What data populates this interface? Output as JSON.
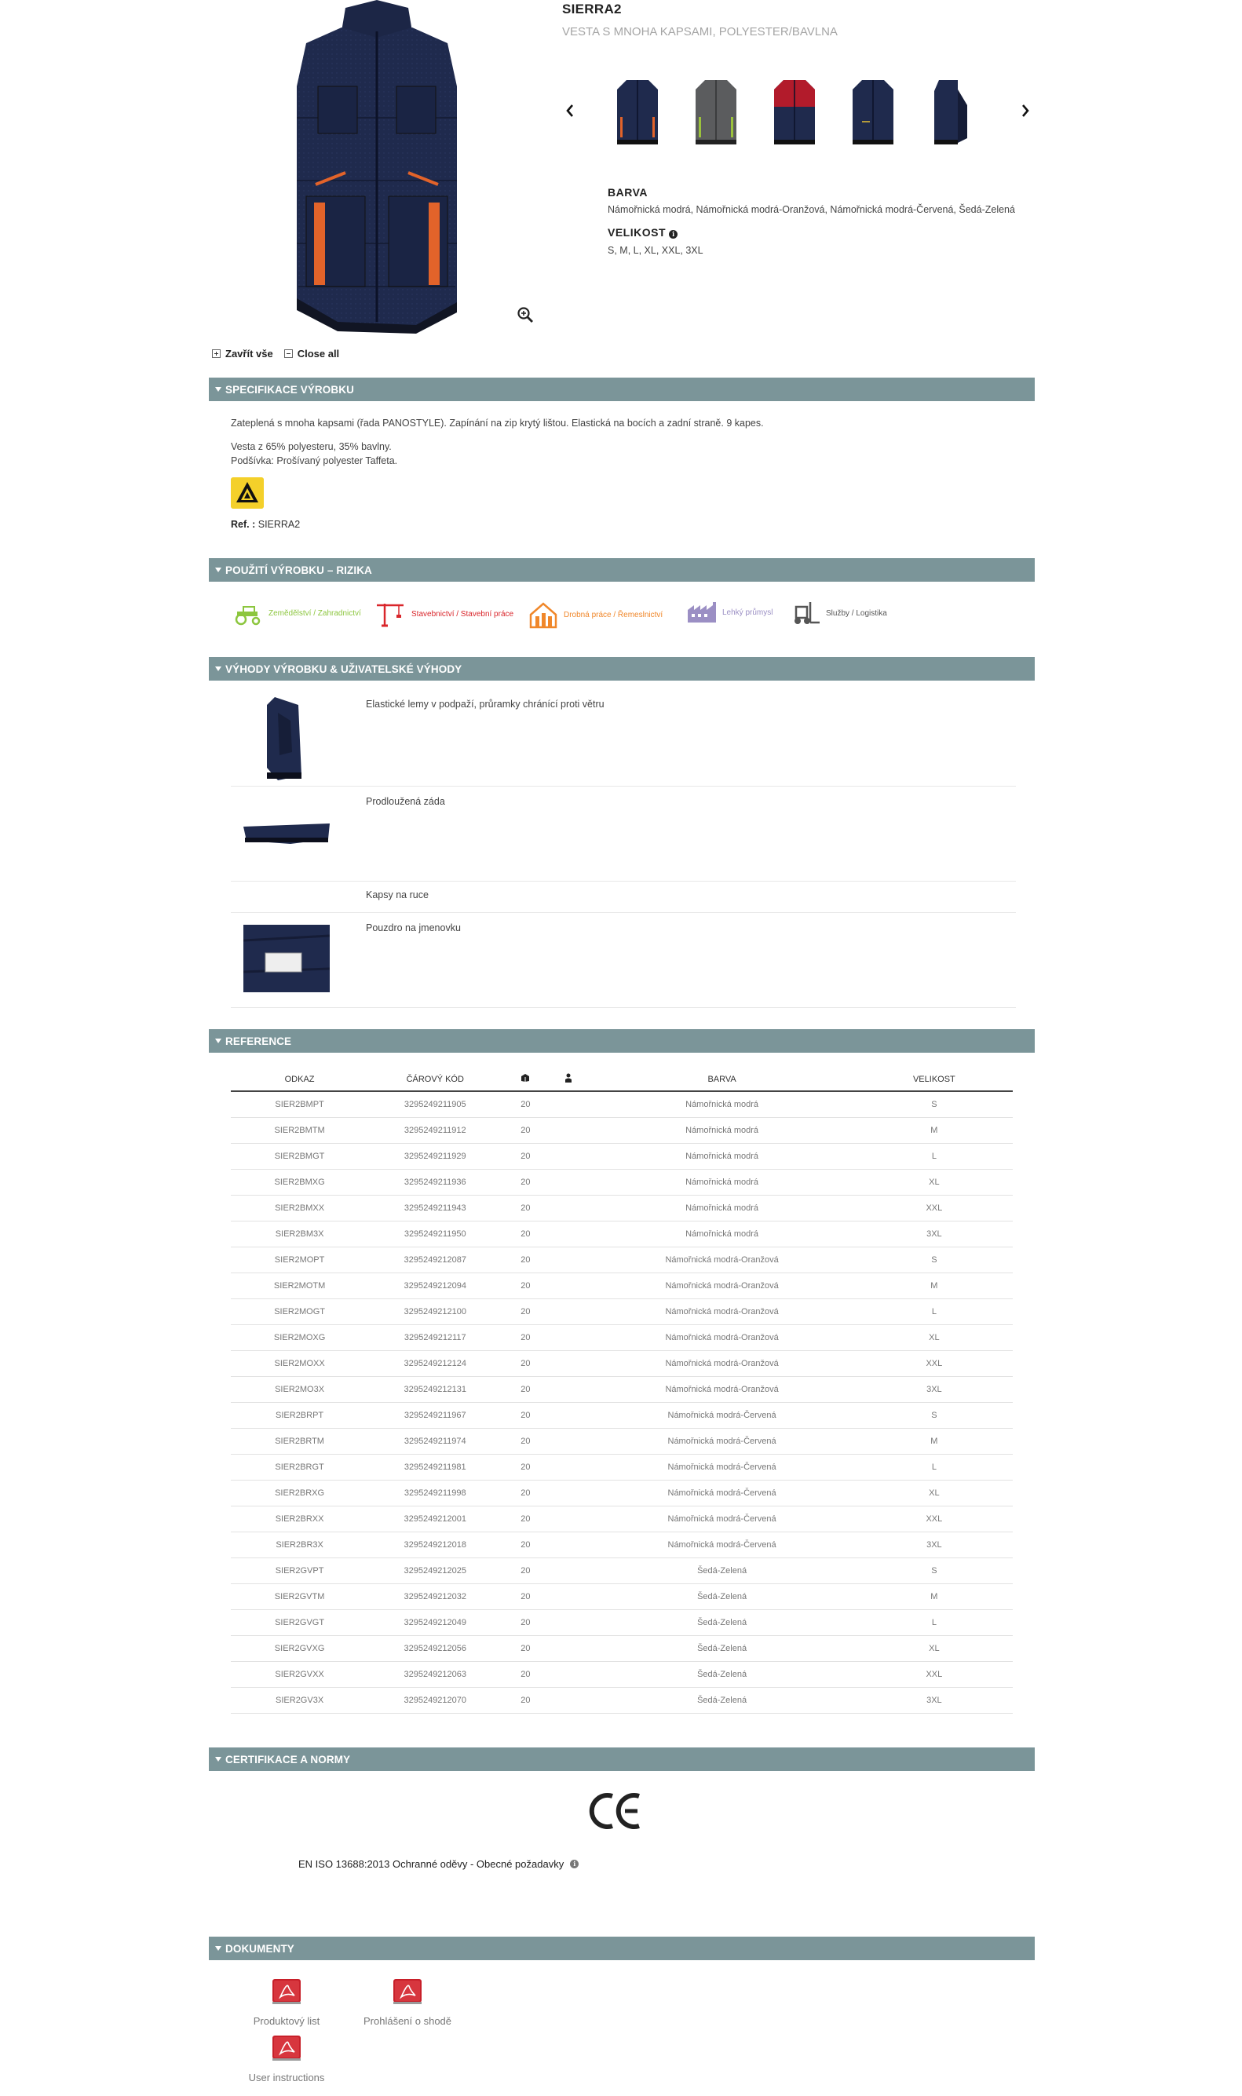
{
  "product": {
    "title": "SIERRA2",
    "subtitle": "VESTA S MNOHA KAPSAMI, POLYESTER/BAVLNA"
  },
  "attributes": {
    "color_label": "BARVA",
    "color_value": "Námořnická modrá, Námořnická modrá-Oranžová, Námořnická modrá-Červená, Šedá-Zelená",
    "size_label": "VELIKOST",
    "size_value": "S, M, L, XL, XXL, 3XL"
  },
  "collapse": {
    "close_cz": "Zavřít vše",
    "close_en": "Close all"
  },
  "sections": {
    "spec": "SPECIFIKACE VÝROBKU",
    "usage": "POUŽITÍ VÝROBKU – RIZIKA",
    "advantages": "VÝHODY VÝROBKU & UŽIVATELSKÉ VÝHODY",
    "reference": "REFERENCE",
    "certification": "CERTIFIKACE A NORMY",
    "documents": "DOKUMENTY"
  },
  "spec": {
    "line1": "Zateplená s mnoha kapsami (řada PANOSTYLE). Zapínání na zip krytý lištou. Elastická na bocích a zadní straně. 9 kapes.",
    "line2": "Vesta z 65% polyesteru, 35% bavlny.",
    "line3": "Podšívka: Prošívaný polyester Taffeta.",
    "ref_label": "Ref. :",
    "ref_value": "SIERRA2"
  },
  "sectors": [
    {
      "label": "Zemědělství / Zahradnictví",
      "color": "#8cc63e",
      "icon": "tractor-icon"
    },
    {
      "label": "Stavebnictví / Stavební práce",
      "color": "#d9262b",
      "icon": "crane-icon"
    },
    {
      "label": "Drobná práce / Řemeslnictví",
      "color": "#f0872a",
      "icon": "house-tools-icon"
    },
    {
      "label": "Lehký průmysl",
      "color": "#9b8fc4",
      "icon": "factory-icon"
    },
    {
      "label": "Služby / Logistika",
      "color": "#555555",
      "icon": "forklift-icon"
    }
  ],
  "advantages": [
    {
      "text": "Elastické lemy v podpaží, průramky chránící proti větru"
    },
    {
      "text": "Prodloužená záda"
    },
    {
      "text": "Kapsy na ruce"
    },
    {
      "text": "Pouzdro na jmenovku"
    }
  ],
  "table": {
    "headers": [
      "ODKAZ",
      "ČÁROVÝ KÓD",
      "",
      "",
      "BARVA",
      "VELIKOST"
    ],
    "rows": [
      [
        "SIER2BMPT",
        "3295249211905",
        "20",
        "",
        "Námořnická modrá",
        "S"
      ],
      [
        "SIER2BMTM",
        "3295249211912",
        "20",
        "",
        "Námořnická modrá",
        "M"
      ],
      [
        "SIER2BMGT",
        "3295249211929",
        "20",
        "",
        "Námořnická modrá",
        "L"
      ],
      [
        "SIER2BMXG",
        "3295249211936",
        "20",
        "",
        "Námořnická modrá",
        "XL"
      ],
      [
        "SIER2BMXX",
        "3295249211943",
        "20",
        "",
        "Námořnická modrá",
        "XXL"
      ],
      [
        "SIER2BM3X",
        "3295249211950",
        "20",
        "",
        "Námořnická modrá",
        "3XL"
      ],
      [
        "SIER2MOPT",
        "3295249212087",
        "20",
        "",
        "Námořnická modrá-Oranžová",
        "S"
      ],
      [
        "SIER2MOTM",
        "3295249212094",
        "20",
        "",
        "Námořnická modrá-Oranžová",
        "M"
      ],
      [
        "SIER2MOGT",
        "3295249212100",
        "20",
        "",
        "Námořnická modrá-Oranžová",
        "L"
      ],
      [
        "SIER2MOXG",
        "3295249212117",
        "20",
        "",
        "Námořnická modrá-Oranžová",
        "XL"
      ],
      [
        "SIER2MOXX",
        "3295249212124",
        "20",
        "",
        "Námořnická modrá-Oranžová",
        "XXL"
      ],
      [
        "SIER2MO3X",
        "3295249212131",
        "20",
        "",
        "Námořnická modrá-Oranžová",
        "3XL"
      ],
      [
        "SIER2BRPT",
        "3295249211967",
        "20",
        "",
        "Námořnická modrá-Červená",
        "S"
      ],
      [
        "SIER2BRTM",
        "3295249211974",
        "20",
        "",
        "Námořnická modrá-Červená",
        "M"
      ],
      [
        "SIER2BRGT",
        "3295249211981",
        "20",
        "",
        "Námořnická modrá-Červená",
        "L"
      ],
      [
        "SIER2BRXG",
        "3295249211998",
        "20",
        "",
        "Námořnická modrá-Červená",
        "XL"
      ],
      [
        "SIER2BRXX",
        "3295249212001",
        "20",
        "",
        "Námořnická modrá-Červená",
        "XXL"
      ],
      [
        "SIER2BR3X",
        "3295249212018",
        "20",
        "",
        "Námořnická modrá-Červená",
        "3XL"
      ],
      [
        "SIER2GVPT",
        "3295249212025",
        "20",
        "",
        "Šedá-Zelená",
        "S"
      ],
      [
        "SIER2GVTM",
        "3295249212032",
        "20",
        "",
        "Šedá-Zelená",
        "M"
      ],
      [
        "SIER2GVGT",
        "3295249212049",
        "20",
        "",
        "Šedá-Zelená",
        "L"
      ],
      [
        "SIER2GVXG",
        "3295249212056",
        "20",
        "",
        "Šedá-Zelená",
        "XL"
      ],
      [
        "SIER2GVXX",
        "3295249212063",
        "20",
        "",
        "Šedá-Zelená",
        "XXL"
      ],
      [
        "SIER2GV3X",
        "3295249212070",
        "20",
        "",
        "Šedá-Zelená",
        "3XL"
      ]
    ]
  },
  "certification": {
    "norm": "EN ISO 13688:2013 Ochranné oděvy - Obecné požadavky"
  },
  "documents": [
    {
      "label": "Produktový list"
    },
    {
      "label": "Prohlášení o shodě"
    },
    {
      "label": "User instructions"
    }
  ],
  "colors": {
    "bar": "#7b9599",
    "navy": "#1f2a4d",
    "orange": "#e2632a",
    "red": "#b21b2b",
    "grey": "#5b5c5e"
  }
}
